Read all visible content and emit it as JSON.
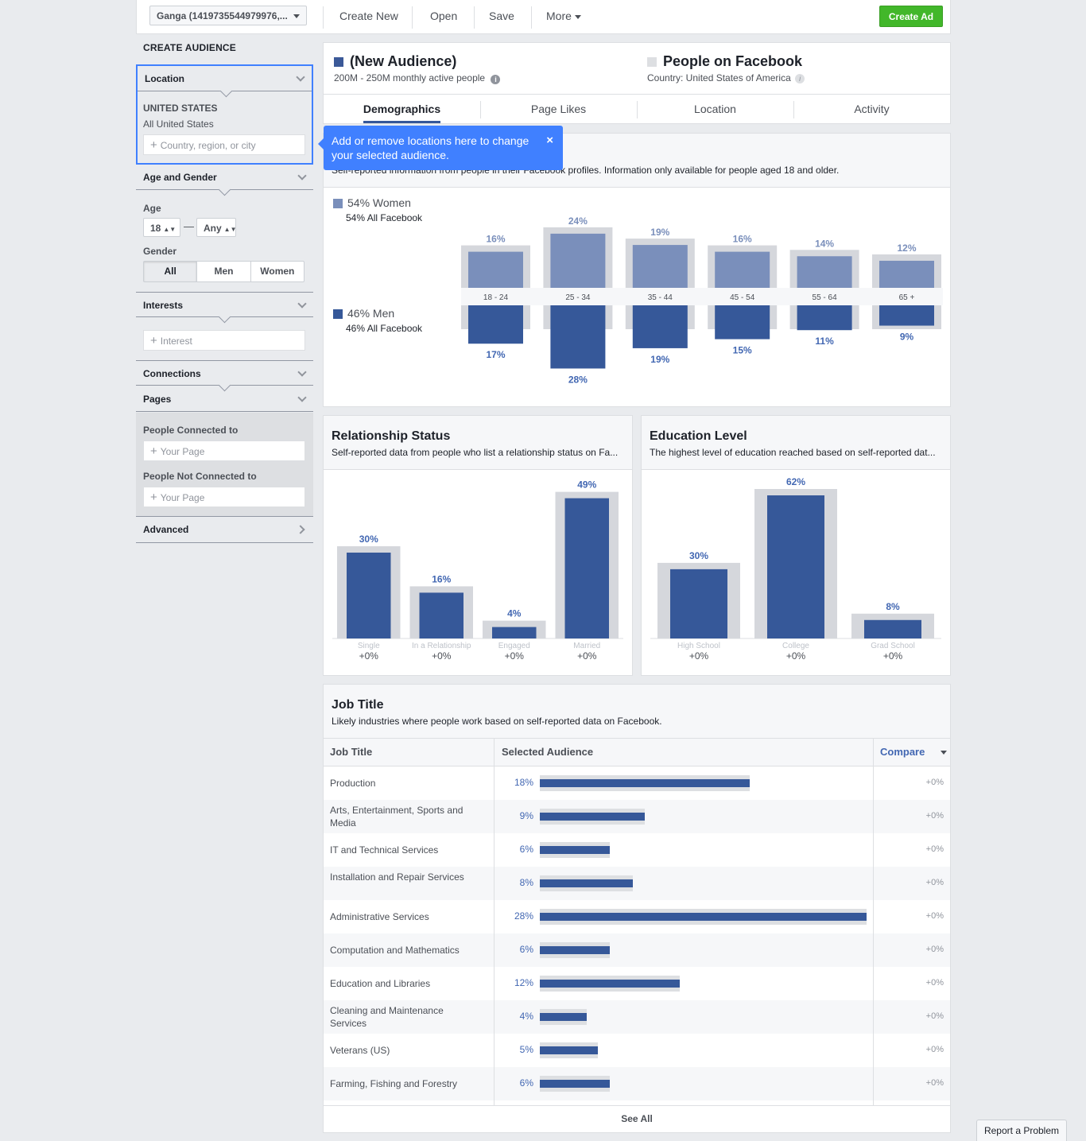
{
  "toolbar": {
    "account": "Ganga (1419735544979976,...",
    "create_new": "Create New",
    "open": "Open",
    "save": "Save",
    "more": "More",
    "create_ad": "Create Ad"
  },
  "sidebar": {
    "title": "CREATE AUDIENCE",
    "location": {
      "label": "Location",
      "country": "UNITED STATES",
      "region": "All United States",
      "placeholder": "Country, region, or city"
    },
    "age_gender": {
      "label": "Age and Gender",
      "age_label": "Age",
      "age_min": "18",
      "age_max": "Any",
      "gender_label": "Gender",
      "gender_options": [
        "All",
        "Men",
        "Women"
      ],
      "gender_selected": "All"
    },
    "interests": {
      "label": "Interests",
      "placeholder": "Interest"
    },
    "connections": {
      "label": "Connections"
    },
    "pages": {
      "label": "Pages",
      "connected_label": "People Connected to",
      "connected_placeholder": "Your Page",
      "not_connected_label": "People Not Connected to",
      "not_connected_placeholder": "Your Page"
    },
    "advanced": {
      "label": "Advanced"
    }
  },
  "tooltip": {
    "text": "Add or remove locations here to change your selected audience.",
    "close": "×"
  },
  "audience": {
    "name": "(New Audience)",
    "size": "200M - 250M monthly active people",
    "compare_name": "People on Facebook",
    "compare_country": "Country: United States of America",
    "colors": {
      "selected": "#3b5998",
      "compare": "#dddfe2"
    }
  },
  "tabs": [
    "Demographics",
    "Page Likes",
    "Location",
    "Activity"
  ],
  "active_tab": "Demographics",
  "demographics": {
    "subtitle": "Self-reported information from people in their Facebook profiles. Information only available for people aged 18 and older.",
    "women_label": "54% Women",
    "women_all": "54% All Facebook",
    "men_label": "46% Men",
    "men_all": "46% All Facebook",
    "colors": {
      "women": "#7a8fbb",
      "men": "#365899",
      "background": "#d5d7dc"
    }
  },
  "relationship": {
    "title": "Relationship Status",
    "subtitle": "Self-reported data from people who list a relationship status on Fa..."
  },
  "education": {
    "title": "Education Level",
    "subtitle": "The highest level of education reached based on self-reported dat..."
  },
  "job_title": {
    "title": "Job Title",
    "subtitle": "Likely industries where people work based on self-reported data on Facebook.",
    "col_job": "Job Title",
    "col_audience": "Selected Audience",
    "col_compare": "Compare",
    "see_all": "See All",
    "rows": [
      {
        "name": "Production",
        "pct": "18%",
        "value": 18,
        "compare": "+0%"
      },
      {
        "name": "Arts, Entertainment, Sports and Media",
        "pct": "9%",
        "value": 9,
        "compare": "+0%"
      },
      {
        "name": "IT and Technical Services",
        "pct": "6%",
        "value": 6,
        "compare": "+0%"
      },
      {
        "name": "Installation and Repair Services",
        "pct": "8%",
        "value": 8,
        "compare": "+0%"
      },
      {
        "name": "Administrative Services",
        "pct": "28%",
        "value": 28,
        "compare": "+0%"
      },
      {
        "name": "Computation and Mathematics",
        "pct": "6%",
        "value": 6,
        "compare": "+0%"
      },
      {
        "name": "Education and Libraries",
        "pct": "12%",
        "value": 12,
        "compare": "+0%"
      },
      {
        "name": "Cleaning and Maintenance Services",
        "pct": "4%",
        "value": 4,
        "compare": "+0%"
      },
      {
        "name": "Veterans (US)",
        "pct": "5%",
        "value": 5,
        "compare": "+0%"
      },
      {
        "name": "Farming, Fishing and Forestry",
        "pct": "6%",
        "value": 6,
        "compare": "+0%"
      }
    ]
  },
  "report_problem": "Report a Problem",
  "chart_data": [
    {
      "type": "bar",
      "categories": [
        "18 - 24",
        "25 - 34",
        "35 - 44",
        "45 - 54",
        "55 - 64",
        "65 +"
      ],
      "series": [
        {
          "name": "54% Women",
          "values": [
            16,
            24,
            19,
            16,
            14,
            12
          ]
        },
        {
          "name": "46% Men",
          "values": [
            17,
            28,
            19,
            15,
            11,
            9
          ]
        }
      ],
      "labels_women": [
        "16%",
        "24%",
        "19%",
        "16%",
        "14%",
        "12%"
      ],
      "labels_men": [
        "17%",
        "28%",
        "19%",
        "15%",
        "11%",
        "9%"
      ],
      "ylim": [
        0,
        30
      ]
    },
    {
      "type": "bar",
      "title": "Relationship Status",
      "categories": [
        "Single",
        "In a Relationship",
        "Engaged",
        "Married"
      ],
      "values": [
        30,
        16,
        4,
        49
      ],
      "labels": [
        "30%",
        "16%",
        "4%",
        "49%"
      ],
      "changes": [
        "+0%",
        "+0%",
        "+0%",
        "+0%"
      ],
      "ylim": [
        0,
        50
      ]
    },
    {
      "type": "bar",
      "title": "Education Level",
      "categories": [
        "High School",
        "College",
        "Grad School"
      ],
      "values": [
        30,
        62,
        8
      ],
      "labels": [
        "30%",
        "62%",
        "8%"
      ],
      "changes": [
        "+0%",
        "+0%",
        "+0%"
      ],
      "ylim": [
        0,
        62
      ]
    }
  ]
}
